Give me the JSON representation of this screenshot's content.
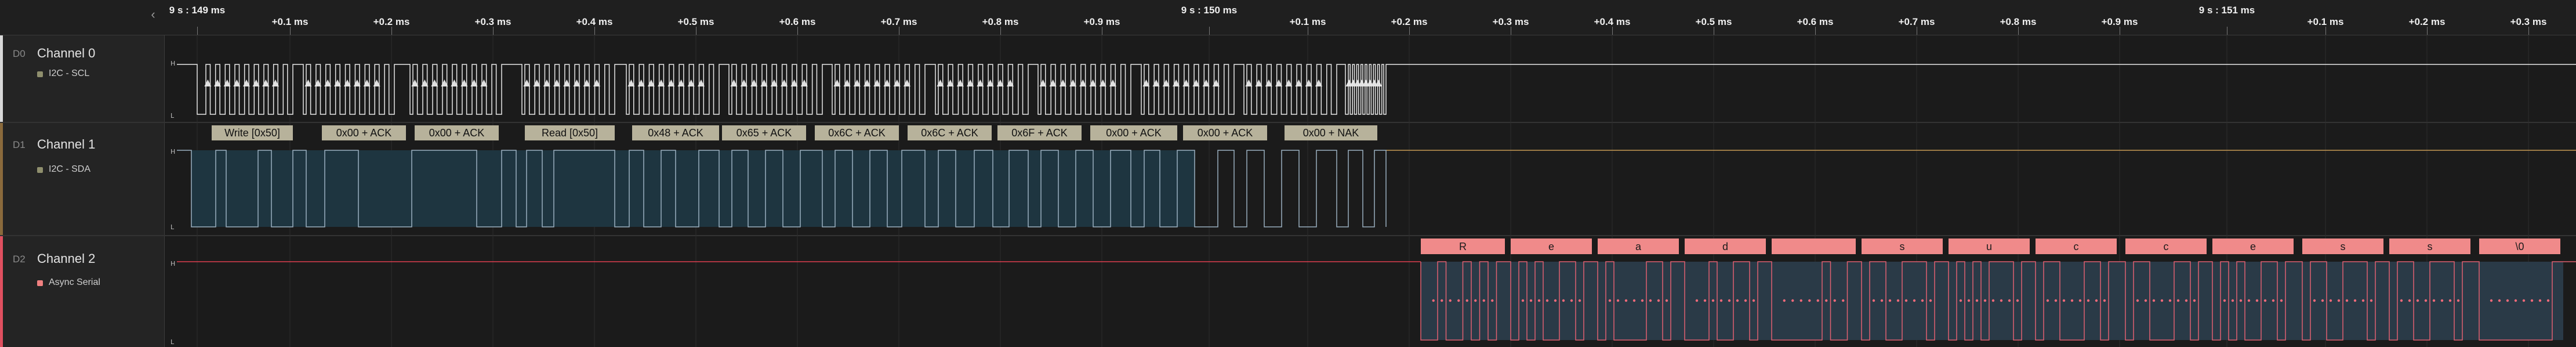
{
  "timeline": {
    "labels": [
      "9 s : 149 ms",
      "+0.1 ms",
      "+0.2 ms",
      "+0.3 ms",
      "+0.4 ms",
      "+0.5 ms",
      "+0.6 ms",
      "+0.7 ms",
      "+0.8 ms",
      "+0.9 ms",
      "9 s : 150 ms",
      "+0.1 ms",
      "+0.2 ms",
      "+0.3 ms",
      "+0.4 ms",
      "+0.5 ms",
      "+0.6 ms",
      "+0.7 ms",
      "+0.8 ms",
      "+0.9 ms",
      "9 s : 151 ms",
      "+0.1 ms",
      "+0.2 ms",
      "+0.3 ms"
    ],
    "collapse_icon": "chevron-left-icon"
  },
  "channels": [
    {
      "id": "D0",
      "name": "Channel 0",
      "analyzer": "I2C - SCL",
      "analyzer_color": "#8f8f6d",
      "stripe_color": "#d8d8d8",
      "signal_color": "#e8e8e8",
      "high_label": "H",
      "low_label": "L"
    },
    {
      "id": "D1",
      "name": "Channel 1",
      "analyzer": "I2C - SDA",
      "analyzer_color": "#8f8f6d",
      "stripe_color": "#8a6a3c",
      "signal_color": "#9ab0c0",
      "high_label": "H",
      "low_label": "L"
    },
    {
      "id": "D2",
      "name": "Channel 2",
      "analyzer": "Async Serial",
      "analyzer_color": "#f08080",
      "stripe_color": "#e05060",
      "signal_color": "#e06070",
      "high_label": "H",
      "low_label": "L"
    }
  ],
  "i2c_frames": [
    "Write [0x50]",
    "0x00 + ACK",
    "0x00 + ACK",
    "Read [0x50]",
    "0x48 + ACK",
    "0x65 + ACK",
    "0x6C + ACK",
    "0x6C + ACK",
    "0x6F + ACK",
    "0x00 + ACK",
    "0x00 + ACK",
    "0x00 + NAK"
  ],
  "serial_frames": [
    "R",
    "e",
    "a",
    "d",
    "",
    "s",
    "u",
    "c",
    "c",
    "e",
    "s",
    "s",
    "\\0"
  ],
  "colors": {
    "i2c_label_bg": "#b7b29b",
    "serial_label_bg": "#f08a8a",
    "sda_fill": "#1e3540",
    "serial_fill": "#2a3a47",
    "sda_idle": "#c79a55",
    "serial_idle": "#e04050"
  }
}
